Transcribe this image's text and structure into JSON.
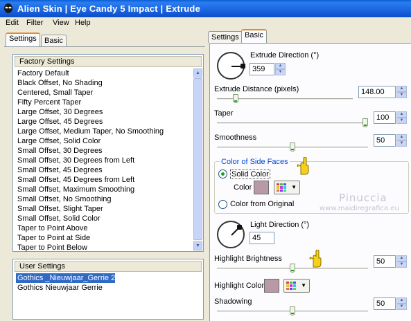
{
  "window": {
    "title": "Alien Skin | Eye Candy 5 Impact | Extrude"
  },
  "menu": [
    "Edit",
    "Filter",
    "View",
    "Help"
  ],
  "left_tabs": [
    "Settings",
    "Basic"
  ],
  "right_tabs": [
    "Settings",
    "Basic"
  ],
  "factory_settings": {
    "header": "Factory Settings",
    "items": [
      "Factory Default",
      "Black Offset, No Shading",
      "Centered, Small Taper",
      "Fifty Percent Taper",
      "Large Offset, 30 Degrees",
      "Large Offset, 45 Degrees",
      "Large Offset, Medium Taper, No Smoothing",
      "Large Offset, Solid Color",
      "Small Offset, 30 Degrees",
      "Small Offset, 30 Degrees from Left",
      "Small Offset, 45 Degrees",
      "Small Offset, 45 Degrees from Left",
      "Small Offset, Maximum Smoothing",
      "Small Offset, No Smoothing",
      "Small Offset, Slight Taper",
      "Small Offset, Solid Color",
      "Taper to Point Above",
      "Taper to Point at Side",
      "Taper to Point Below"
    ]
  },
  "user_settings": {
    "header": "User Settings",
    "items": [
      {
        "label": "Gothics _Nieuwjaar_Gerrie 2",
        "selected": true
      },
      {
        "label": "Gothics  Nieuwjaar   Gerrie",
        "selected": false
      }
    ]
  },
  "basic": {
    "extrude_direction": {
      "label": "Extrude Direction (°)",
      "value": "359"
    },
    "extrude_distance": {
      "label": "Extrude Distance (pixels)",
      "value": "148.00",
      "fraction": 0.12
    },
    "taper": {
      "label": "Taper",
      "value": "100",
      "fraction": 1.0
    },
    "smoothness": {
      "label": "Smoothness",
      "value": "50",
      "fraction": 0.5
    },
    "color_of_side_faces": {
      "title": "Color of Side Faces",
      "solid_color": "Solid Color",
      "color_label": "Color",
      "from_original": "Color from Original",
      "selected": "solid",
      "swatch": "#b899a6"
    },
    "light_direction": {
      "label": "Light Direction (°)",
      "value": "45"
    },
    "highlight_brightness": {
      "label": "Highlight Brightness",
      "value": "50",
      "fraction": 0.5
    },
    "highlight_color": {
      "label": "Highlight Color",
      "swatch": "#b899a6"
    },
    "shadowing": {
      "label": "Shadowing",
      "value": "50",
      "fraction": 0.5
    }
  },
  "watermark": {
    "name": "Pinuccia",
    "site": "www.maidiregrafica.eu"
  },
  "colors": {
    "titlebar": "#1a64e0",
    "selection": "#316ac5",
    "group_title": "#0046d5"
  },
  "icons": [
    "alien-skin-app-icon",
    "color-picker-icon",
    "pointing-hand-icon"
  ]
}
